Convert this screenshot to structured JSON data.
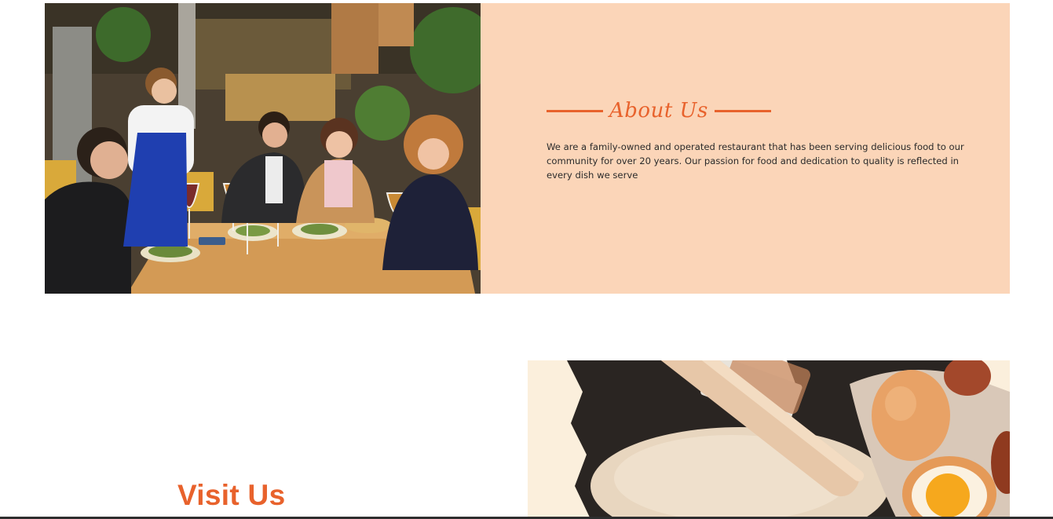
{
  "about": {
    "heading": "About Us",
    "body": "We are a family-owned and operated restaurant that has been serving delicious food to our community for over 20 years. Our passion for food and dedication to quality is reflected in every dish we serve",
    "photo_icon": "restaurant-dining-photo",
    "panel_color": "#fbd5b8",
    "accent_color": "#e8622c"
  },
  "visit": {
    "heading": "Visit Us",
    "photo_icon": "baking-ingredients-photo"
  }
}
